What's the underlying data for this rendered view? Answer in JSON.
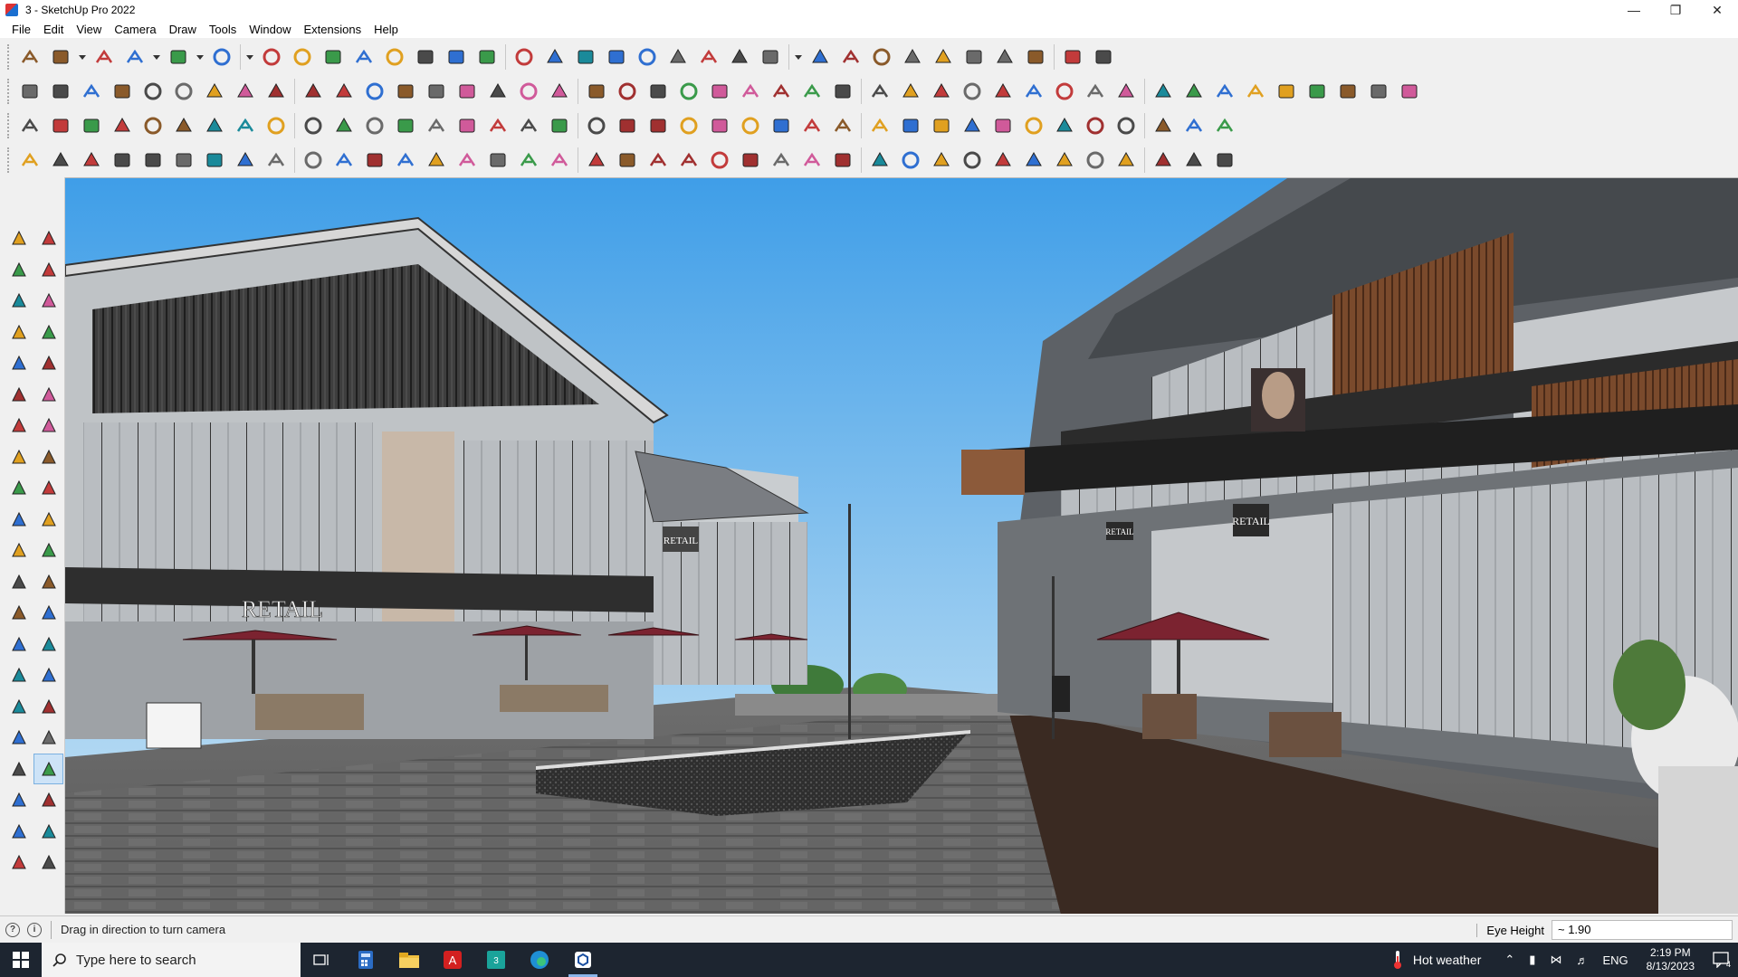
{
  "window": {
    "title": "3 - SketchUp Pro 2022",
    "controls": [
      "minimize",
      "maximize",
      "close"
    ]
  },
  "menu": {
    "items": [
      "File",
      "Edit",
      "View",
      "Camera",
      "Draw",
      "Tools",
      "Window",
      "Extensions",
      "Help"
    ]
  },
  "toolbars": {
    "row1": [
      "search-icon",
      "select-arrow-icon",
      "dropdown-icon",
      "eraser-icon",
      "pencil-icon",
      "dropdown-icon",
      "freehand-icon",
      "dropdown-icon",
      "rectangle-icon",
      "dropdown-icon",
      "push-pull-icon",
      "follow-me-icon",
      "move-icon",
      "rotate-icon",
      "scale-icon",
      "tape-measure-icon",
      "text-icon",
      "paint-bucket-icon",
      "orbit-icon",
      "pan-icon",
      "zoom-icon",
      "zoom-extents-icon",
      "warehouse-icon",
      "extension-warehouse-icon",
      "layers-icon",
      "sandbox-icon",
      "user-account-icon",
      "dropdown-icon",
      "solid-union-icon",
      "solid-subtract-icon",
      "dimension-icon",
      "push-arrows-icon",
      "pull-arrows-icon",
      "measure-line-icon",
      "section-icon",
      "undo-icon",
      "redo-icon",
      "hand-icon"
    ],
    "row2": [
      "iso-view-icon",
      "top-view-icon",
      "front-view-icon",
      "push-red-icon",
      "push-down-icon",
      "push-blue-icon",
      "arrow-r-icon",
      "arrow-v-icon",
      "arrow-n-icon",
      "arrow-x-icon",
      "arrow-f-icon",
      "curve-icon",
      "solid-tool-a-icon",
      "solid-tool-b-icon",
      "solid-tool-c-icon",
      "terrain-icon",
      "drape-icon",
      "house-a-icon",
      "door-icon",
      "house-icon",
      "home-icon",
      "house-outline-icon",
      "roof-icon",
      "fx-icon",
      "bubble-icon",
      "pencil-red-icon",
      "rect-outline-icon",
      "circle-outline-icon",
      "hexagon-icon",
      "ellipse-icon",
      "parallelogram-icon",
      "arc-icon",
      "spiral-icon",
      "lasso-icon",
      "bezier-icon",
      "polygon-icon",
      "curve-arrow-icon",
      "eraser-pink-icon",
      "material-a-icon",
      "material-b-icon",
      "render-a-icon",
      "render-b-icon",
      "render-c-icon",
      "render-d-icon",
      "render-e-icon"
    ],
    "row3": [
      "blue-plane-icon",
      "blue-plane-b-icon",
      "yellow-plane-icon",
      "green-plane-icon",
      "red-plane-icon",
      "white-plane-icon",
      "orange-loop-icon",
      "red-square-icon",
      "stack-icon",
      "frame-icon",
      "box-icon",
      "chain-icon",
      "bend-icon",
      "spline-icon",
      "plus-red-icon",
      "plus-green-icon",
      "cross-blue-icon",
      "cone-icon",
      "flame-icon",
      "triangle-icon",
      "ring-icon",
      "donut-icon",
      "loop-icon",
      "star-move-icon",
      "cube-icon",
      "magnet-icon",
      "green-tree-icon",
      "puzzle-icon",
      "puzzle-b-icon",
      "puzzle-c-icon",
      "red-gem-icon",
      "grid-icon",
      "table-icon",
      "orange-grid-icon",
      "orange-grid-b-icon",
      "orange-grid-c-icon",
      "scatter-icon",
      "dotted-arc-icon",
      "qr-icon"
    ],
    "row4": [
      "line-nodes-icon",
      "curve-nodes-icon",
      "red-car-icon",
      "scissors-icon",
      "gear-icon",
      "bird-icon",
      "hook-icon",
      "shape-a-icon",
      "sphere-icon",
      "knife-icon",
      "corner-icon",
      "corner-b-icon",
      "needle-icon",
      "bow-icon",
      "stairs-icon",
      "sail-icon",
      "grille-icon",
      "column-icon",
      "paw-icon",
      "leaf-icon",
      "bird-b-icon",
      "ladder-icon",
      "hatch-icon",
      "rail-icon",
      "rail-b-icon",
      "rail-c-icon",
      "pipe-icon",
      "hatch-b-icon",
      "block-icon",
      "block-b-icon",
      "fence-icon",
      "fence-b-icon",
      "fence-c-icon",
      "fence-d-icon",
      "globe-icon",
      "globe-b-icon",
      "hatch-c-icon",
      "hatch-d-icon",
      "hexagon-tile-icon"
    ]
  },
  "left_toolbar": [
    "select-icon",
    "orbit-icon",
    "paint-bucket-icon",
    "eraser-icon",
    "component-icon",
    "tape-icon",
    "line-icon",
    "freehand-icon",
    "rectangle-icon",
    "rotated-rect-icon",
    "circle-icon",
    "polygon-icon",
    "arc-icon",
    "two-point-arc-icon",
    "three-point-arc-icon",
    "pie-icon",
    "move-icon",
    "push-pull-icon",
    "rotate-icon",
    "follow-me-icon",
    "scale-icon",
    "offset-icon",
    "tape-measure-icon",
    "dimension-icon",
    "protractor-icon",
    "text-icon",
    "axes-icon",
    "3d-text-icon",
    "orbit-b-icon",
    "pan-icon",
    "zoom-icon",
    "zoom-window-icon",
    "zoom-extents-icon",
    "zoom-previous-icon",
    "position-camera-icon",
    "look-around-icon",
    "walk-icon",
    "section-plane-icon",
    "warehouse-icon",
    "extension-icon",
    "layers-icon",
    "sandbox-icon"
  ],
  "left_toolbar_active": "look-around-icon",
  "viewport": {
    "scene_signs": [
      "RETAIL",
      "RETAIL",
      "RETAIL",
      "RETAIL"
    ]
  },
  "status": {
    "message": "Drag in direction to turn camera",
    "measurement_label": "Eye Height",
    "measurement_value": "~ 1.90"
  },
  "taskbar": {
    "search_placeholder": "Type here to search",
    "apps": [
      "task-view-icon",
      "calculator-icon",
      "file-explorer-icon",
      "acrobat-icon",
      "3ds-max-icon",
      "edge-icon",
      "sketchup-icon"
    ],
    "weather": "Hot weather",
    "language": "ENG",
    "time": "2:19 PM",
    "date": "8/13/2023",
    "notification_count": "4"
  },
  "colors": {
    "sky_top": "#3f9ee8",
    "sky_bottom": "#c8e3f3",
    "taskbar": "#1d2530",
    "awning": "#7b2330"
  }
}
